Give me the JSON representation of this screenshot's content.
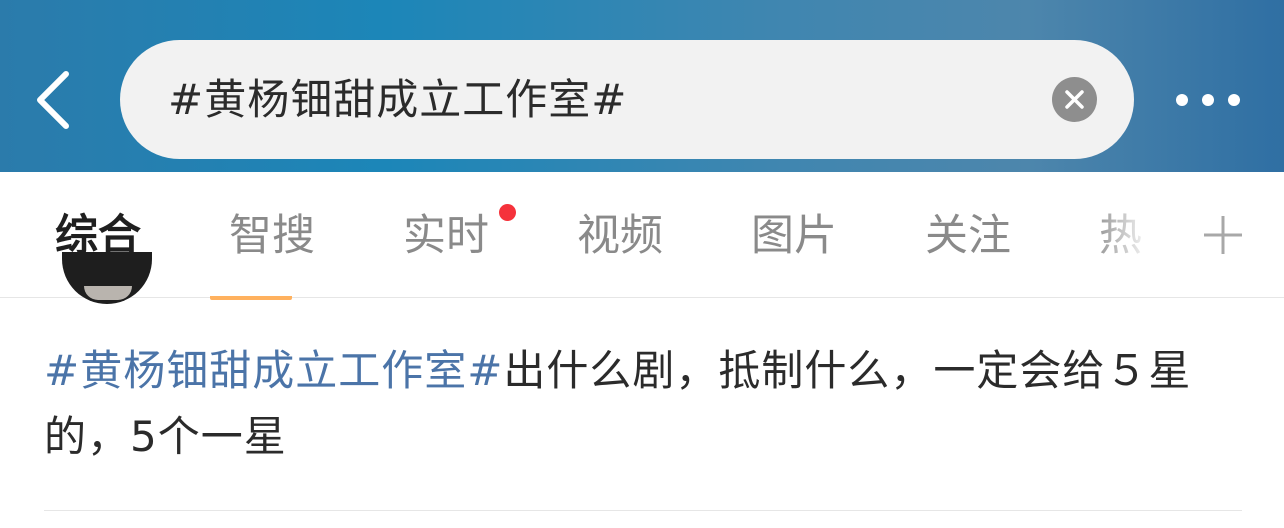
{
  "header": {
    "back_icon": "chevron-left-icon",
    "search": {
      "query": "#黄杨钿甜成立工作室#"
    },
    "clear_icon": "close-circle-icon",
    "more_icon": "more-dots-icon",
    "gradient_colors": [
      "#2b7bab",
      "#1c86b8",
      "#4d86ac",
      "#2f6fa3"
    ]
  },
  "tabs": {
    "items": [
      {
        "label": "综合"
      },
      {
        "label": "智搜"
      },
      {
        "label": "实时"
      },
      {
        "label": "视频"
      },
      {
        "label": "图片"
      },
      {
        "label": "关注"
      },
      {
        "label": "热"
      }
    ],
    "active_index": 0,
    "plus_icon": "plus-icon",
    "active_color": "#1f1f1f",
    "underline_color": "#ff8200",
    "dot_color": "#f5323b"
  },
  "post": {
    "hashtag": "#黄杨钿甜成立工作室#",
    "body": "出什么剧，抵制什么，一定会给５星的，5个一星",
    "hashtag_color": "#4b74a8"
  }
}
